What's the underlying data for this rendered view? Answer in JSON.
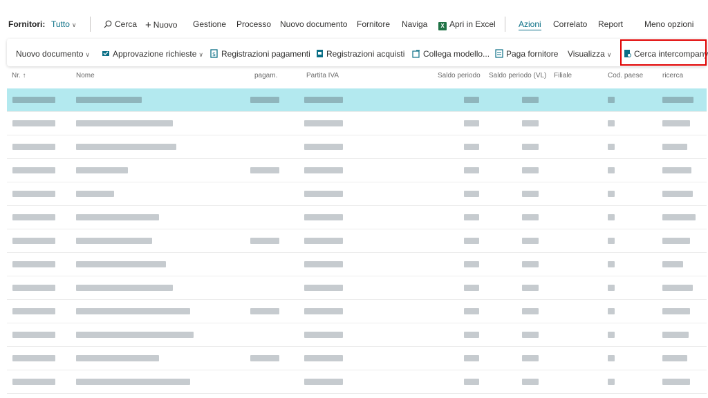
{
  "actionbar": {
    "title": "Fornitori:",
    "filter": "Tutto",
    "search": "Cerca",
    "new": "Nuovo",
    "menu": [
      "Gestione",
      "Processo",
      "Nuovo documento",
      "Fornitore",
      "Naviga"
    ],
    "excel": "Apri in Excel",
    "tabs": [
      "Azioni",
      "Correlato",
      "Report",
      "Meno opzioni"
    ],
    "active_tab": "Azioni"
  },
  "subbar": {
    "items": [
      {
        "label": "Nuovo documento",
        "dropdown": true,
        "icon": ""
      },
      {
        "label": "Approvazione richieste",
        "dropdown": true,
        "icon": "approval-icon"
      },
      {
        "label": "Registrazioni pagamenti",
        "dropdown": false,
        "icon": "payment-entries-icon"
      },
      {
        "label": "Registrazioni acquisti",
        "dropdown": false,
        "icon": "purchase-entries-icon"
      },
      {
        "label": "Collega modello...",
        "dropdown": false,
        "icon": "link-template-icon"
      },
      {
        "label": "Paga fornitore",
        "dropdown": false,
        "icon": "pay-vendor-icon"
      },
      {
        "label": "Visualizza",
        "dropdown": true,
        "icon": ""
      },
      {
        "label": "Cerca intercompany",
        "dropdown": false,
        "icon": "intercompany-icon"
      }
    ]
  },
  "columns": [
    "Nr. ↑",
    "Nome",
    "pagam.",
    "Partita IVA",
    "Saldo periodo",
    "Saldo periodo (VL)",
    "Filiale",
    "Cod. paese",
    "ricerca"
  ],
  "rows_note_hidden": true,
  "colors": {
    "accent": "#0a6f86",
    "selected_row": "#b3e9ef",
    "highlight_box": "#e00000",
    "excel_green": "#217346"
  }
}
